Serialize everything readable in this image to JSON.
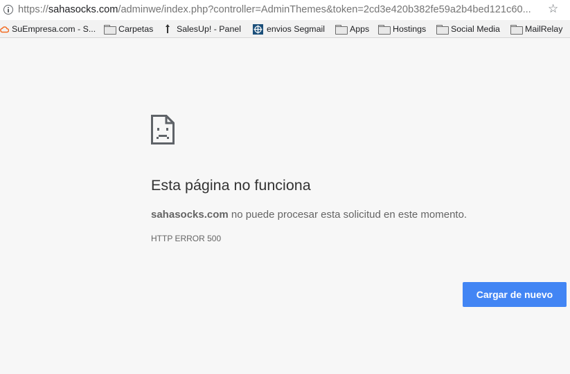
{
  "browser": {
    "url_scheme": "https://",
    "url_host": "sahasocks.com",
    "url_path": "/adminwe/index.php?controller=AdminThemes&token=2cd3e420b382fe59a2b4bed121c60..."
  },
  "bookmarks": [
    {
      "label": "SuEmpresa.com - S...",
      "icon": "cloud-icon"
    },
    {
      "label": "Carpetas",
      "icon": "folder-icon"
    },
    {
      "label": "SalesUp! - Panel",
      "icon": "pin-icon"
    },
    {
      "label": "envios Segmail",
      "icon": "segmail-icon"
    },
    {
      "label": "Apps",
      "icon": "folder-icon"
    },
    {
      "label": "Hostings",
      "icon": "folder-icon"
    },
    {
      "label": "Social Media",
      "icon": "folder-icon"
    },
    {
      "label": "MailRelay",
      "icon": "folder-icon"
    }
  ],
  "error": {
    "title": "Esta página no funciona",
    "domain": "sahasocks.com",
    "message": " no puede procesar esta solicitud en este momento.",
    "code": "HTTP ERROR 500",
    "reload_label": "Cargar de nuevo"
  },
  "colors": {
    "button": "#4285f4",
    "page_background": "#f7f7f7",
    "cloud_icon": "#f26b21",
    "segmail_icon": "#1b4f7a"
  }
}
